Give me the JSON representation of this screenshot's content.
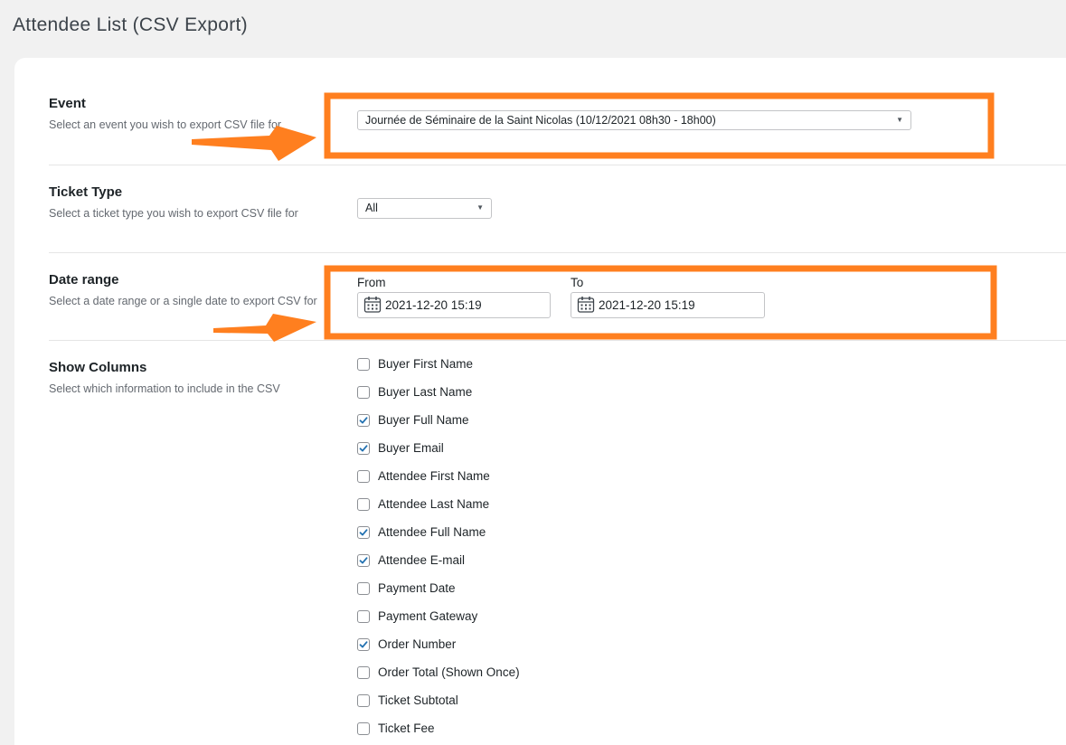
{
  "page": {
    "title": "Attendee List (CSV Export)"
  },
  "event": {
    "title": "Event",
    "description": "Select an event you wish to export CSV file for",
    "selected": "Journée de Séminaire de la Saint Nicolas (10/12/2021 08h30 - 18h00)"
  },
  "ticket_type": {
    "title": "Ticket Type",
    "description": "Select a ticket type you wish to export CSV file for",
    "selected": "All"
  },
  "date_range": {
    "title": "Date range",
    "description": "Select a date range or a single date to export CSV for",
    "from_label": "From",
    "from_value": "2021-12-20 15:19",
    "to_label": "To",
    "to_value": "2021-12-20 15:19"
  },
  "columns": {
    "title": "Show Columns",
    "description": "Select which information to include in the CSV",
    "items": [
      {
        "label": "Buyer First Name",
        "checked": false
      },
      {
        "label": "Buyer Last Name",
        "checked": false
      },
      {
        "label": "Buyer Full Name",
        "checked": true
      },
      {
        "label": "Buyer Email",
        "checked": true
      },
      {
        "label": "Attendee First Name",
        "checked": false
      },
      {
        "label": "Attendee Last Name",
        "checked": false
      },
      {
        "label": "Attendee Full Name",
        "checked": true
      },
      {
        "label": "Attendee E-mail",
        "checked": true
      },
      {
        "label": "Payment Date",
        "checked": false
      },
      {
        "label": "Payment Gateway",
        "checked": false
      },
      {
        "label": "Order Number",
        "checked": true
      },
      {
        "label": "Order Total (Shown Once)",
        "checked": false
      },
      {
        "label": "Ticket Subtotal",
        "checked": false
      },
      {
        "label": "Ticket Fee",
        "checked": false
      }
    ]
  },
  "colors": {
    "highlight": "#ff7f1f",
    "check": "#2271b1"
  },
  "icons": {
    "calendar": "calendar-icon",
    "arrow": "arrow-right-icon",
    "caret": "caret-down-icon"
  }
}
